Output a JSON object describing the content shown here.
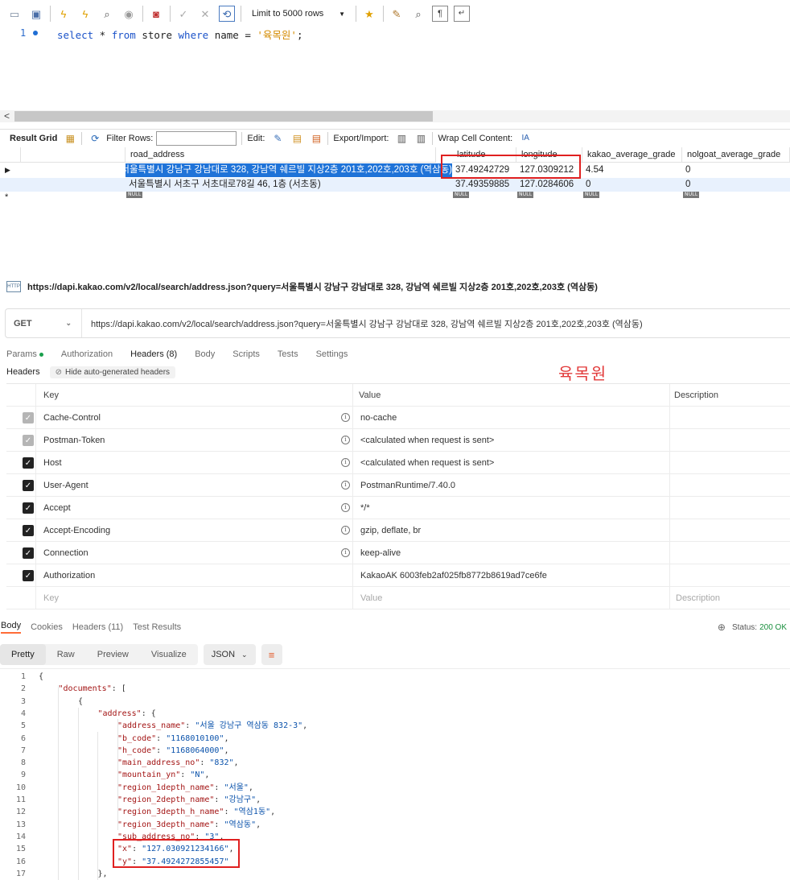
{
  "workbench": {
    "limit_label": "Limit to 5000 rows",
    "sql": {
      "line_number": "1",
      "select_kw": "select",
      "star": " * ",
      "from_kw": "from",
      "table": " store ",
      "where_kw": "where",
      "col": " name = ",
      "value": "'육목원'",
      "end": ";"
    },
    "result_toolbar": {
      "result_grid": "Result Grid",
      "filter_rows": "Filter Rows:",
      "edit": "Edit:",
      "export_import": "Export/Import:",
      "wrap_cell": "Wrap Cell Content:"
    },
    "columns": [
      "road_address",
      "latitude",
      "longitude",
      "kakao_average_grade",
      "nolgoat_average_grade"
    ],
    "rows": [
      {
        "road_address": "서울특별시 강남구 강남대로 328, 강남역 쉐르빌 지상2층 201호,202호,203호 (역삼동)",
        "latitude": "37.49242729",
        "longitude": "127.0309212",
        "kakao": "4.54",
        "nolgoat": "0"
      },
      {
        "road_address": "서울특별시 서초구 서초대로78길 46, 1층 (서초동)",
        "latitude": "37.49359885",
        "longitude": "127.0284606",
        "kakao": "0",
        "nolgoat": "0"
      }
    ],
    "null_label": "NULL",
    "new_row_marker": "*"
  },
  "postman": {
    "title_url": "https://dapi.kakao.com/v2/local/search/address.json?query=서울특별시 강남구 강남대로 328, 강남역 쉐르빌 지상2층 201호,202호,203호 (역삼동)",
    "http_badge": "HTTP",
    "method": "GET",
    "url": "https://dapi.kakao.com/v2/local/search/address.json?query=서울특별시 강남구 강남대로 328, 강남역 쉐르빌 지상2층 201호,202호,203호 (역삼동)",
    "req_tabs": [
      "Params",
      "Authorization",
      "Headers (8)",
      "Body",
      "Scripts",
      "Tests",
      "Settings"
    ],
    "headers_label": "Headers",
    "hide_auto": "Hide auto-generated headers",
    "annotation": "육목원",
    "table_cols": [
      "Key",
      "Value",
      "Description"
    ],
    "headers": [
      {
        "key": "Cache-Control",
        "value": "no-cache",
        "state": "dim",
        "info": true
      },
      {
        "key": "Postman-Token",
        "value": "<calculated when request is sent>",
        "state": "dim",
        "info": true
      },
      {
        "key": "Host",
        "value": "<calculated when request is sent>",
        "state": "on",
        "info": true
      },
      {
        "key": "User-Agent",
        "value": "PostmanRuntime/7.40.0",
        "state": "on",
        "info": true
      },
      {
        "key": "Accept",
        "value": "*/*",
        "state": "on",
        "info": true
      },
      {
        "key": "Accept-Encoding",
        "value": "gzip, deflate, br",
        "state": "on",
        "info": true
      },
      {
        "key": "Connection",
        "value": "keep-alive",
        "state": "on",
        "info": true
      },
      {
        "key": "Authorization",
        "value": "KakaoAK 6003feb2af025fb8772b8619ad7ce6fe",
        "state": "on",
        "info": false
      }
    ],
    "placeholder_row": {
      "key": "Key",
      "value": "Value",
      "description": "Description"
    },
    "resp_tabs": [
      "Body",
      "Cookies",
      "Headers (11)",
      "Test Results"
    ],
    "status_label": "Status:",
    "status_value": "200 OK",
    "format_options": [
      "Pretty",
      "Raw",
      "Preview",
      "Visualize"
    ],
    "format_type": "JSON",
    "json_lines": [
      {
        "n": "1",
        "indent": 0,
        "k": "",
        "v": "",
        "p": "{"
      },
      {
        "n": "2",
        "indent": 1,
        "k": "\"documents\"",
        "v": "",
        "p": ": ["
      },
      {
        "n": "3",
        "indent": 2,
        "k": "",
        "v": "",
        "p": "{"
      },
      {
        "n": "4",
        "indent": 3,
        "k": "\"address\"",
        "v": "",
        "p": ": {"
      },
      {
        "n": "5",
        "indent": 4,
        "k": "\"address_name\"",
        "v": "\"서울 강남구 역삼동 832-3\"",
        "p": ","
      },
      {
        "n": "6",
        "indent": 4,
        "k": "\"b_code\"",
        "v": "\"1168010100\"",
        "p": ","
      },
      {
        "n": "7",
        "indent": 4,
        "k": "\"h_code\"",
        "v": "\"1168064000\"",
        "p": ","
      },
      {
        "n": "8",
        "indent": 4,
        "k": "\"main_address_no\"",
        "v": "\"832\"",
        "p": ","
      },
      {
        "n": "9",
        "indent": 4,
        "k": "\"mountain_yn\"",
        "v": "\"N\"",
        "p": ","
      },
      {
        "n": "10",
        "indent": 4,
        "k": "\"region_1depth_name\"",
        "v": "\"서울\"",
        "p": ","
      },
      {
        "n": "11",
        "indent": 4,
        "k": "\"region_2depth_name\"",
        "v": "\"강남구\"",
        "p": ","
      },
      {
        "n": "12",
        "indent": 4,
        "k": "\"region_3depth_h_name\"",
        "v": "\"역삼1동\"",
        "p": ","
      },
      {
        "n": "13",
        "indent": 4,
        "k": "\"region_3depth_name\"",
        "v": "\"역삼동\"",
        "p": ","
      },
      {
        "n": "14",
        "indent": 4,
        "k": "\"sub_address_no\"",
        "v": "\"3\"",
        "p": ","
      },
      {
        "n": "15",
        "indent": 4,
        "k": "\"x\"",
        "v": "\"127.030921234166\"",
        "p": ","
      },
      {
        "n": "16",
        "indent": 4,
        "k": "\"y\"",
        "v": "\"37.4924272855457\"",
        "p": ""
      },
      {
        "n": "17",
        "indent": 3,
        "k": "",
        "v": "",
        "p": "},"
      }
    ]
  }
}
